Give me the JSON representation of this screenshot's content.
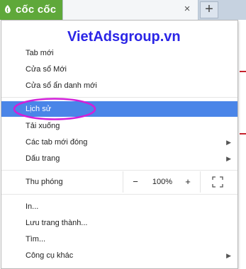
{
  "browser": {
    "logo_text": "cốc cốc",
    "new_tab_symbol": "+",
    "close_symbol": "×"
  },
  "watermark": "VietAdsgroup.vn",
  "menu": {
    "new_tab": "Tab mới",
    "new_window": "Cửa sổ Mới",
    "incognito_window": "Cửa sổ ẩn danh mới",
    "history": "Lịch sử",
    "downloads": "Tải xuống",
    "recently_closed_tabs": "Các tab mới đóng",
    "bookmarks": "Dấu trang",
    "zoom": {
      "label": "Thu phóng",
      "minus": "−",
      "value": "100%",
      "plus": "+"
    },
    "print": "In...",
    "save_page": "Lưu trang thành...",
    "find": "Tìm...",
    "more_tools": "Công cụ khác",
    "submenu_arrow": "▶"
  },
  "colors": {
    "selected_background": "#4a85e8",
    "highlight_ellipse": "#d21fd8",
    "watermark": "#2b25e6",
    "logo_background": "#5fa83a"
  }
}
